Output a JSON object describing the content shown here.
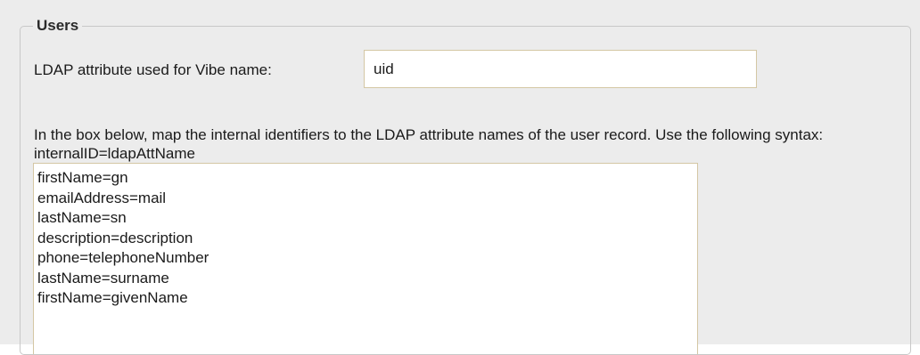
{
  "users_section": {
    "legend": "Users",
    "vibe_name_label": "LDAP attribute used for Vibe name:",
    "vibe_name_value": "uid",
    "mapping_description": "In the box below, map the internal identifiers to the LDAP attribute names of the user record. Use the following syntax: internalID=ldapAttName",
    "mappings": [
      "firstName=gn",
      "emailAddress=mail",
      "lastName=sn",
      "description=description",
      "phone=telephoneNumber",
      "lastName=surname",
      "firstName=givenName"
    ]
  }
}
